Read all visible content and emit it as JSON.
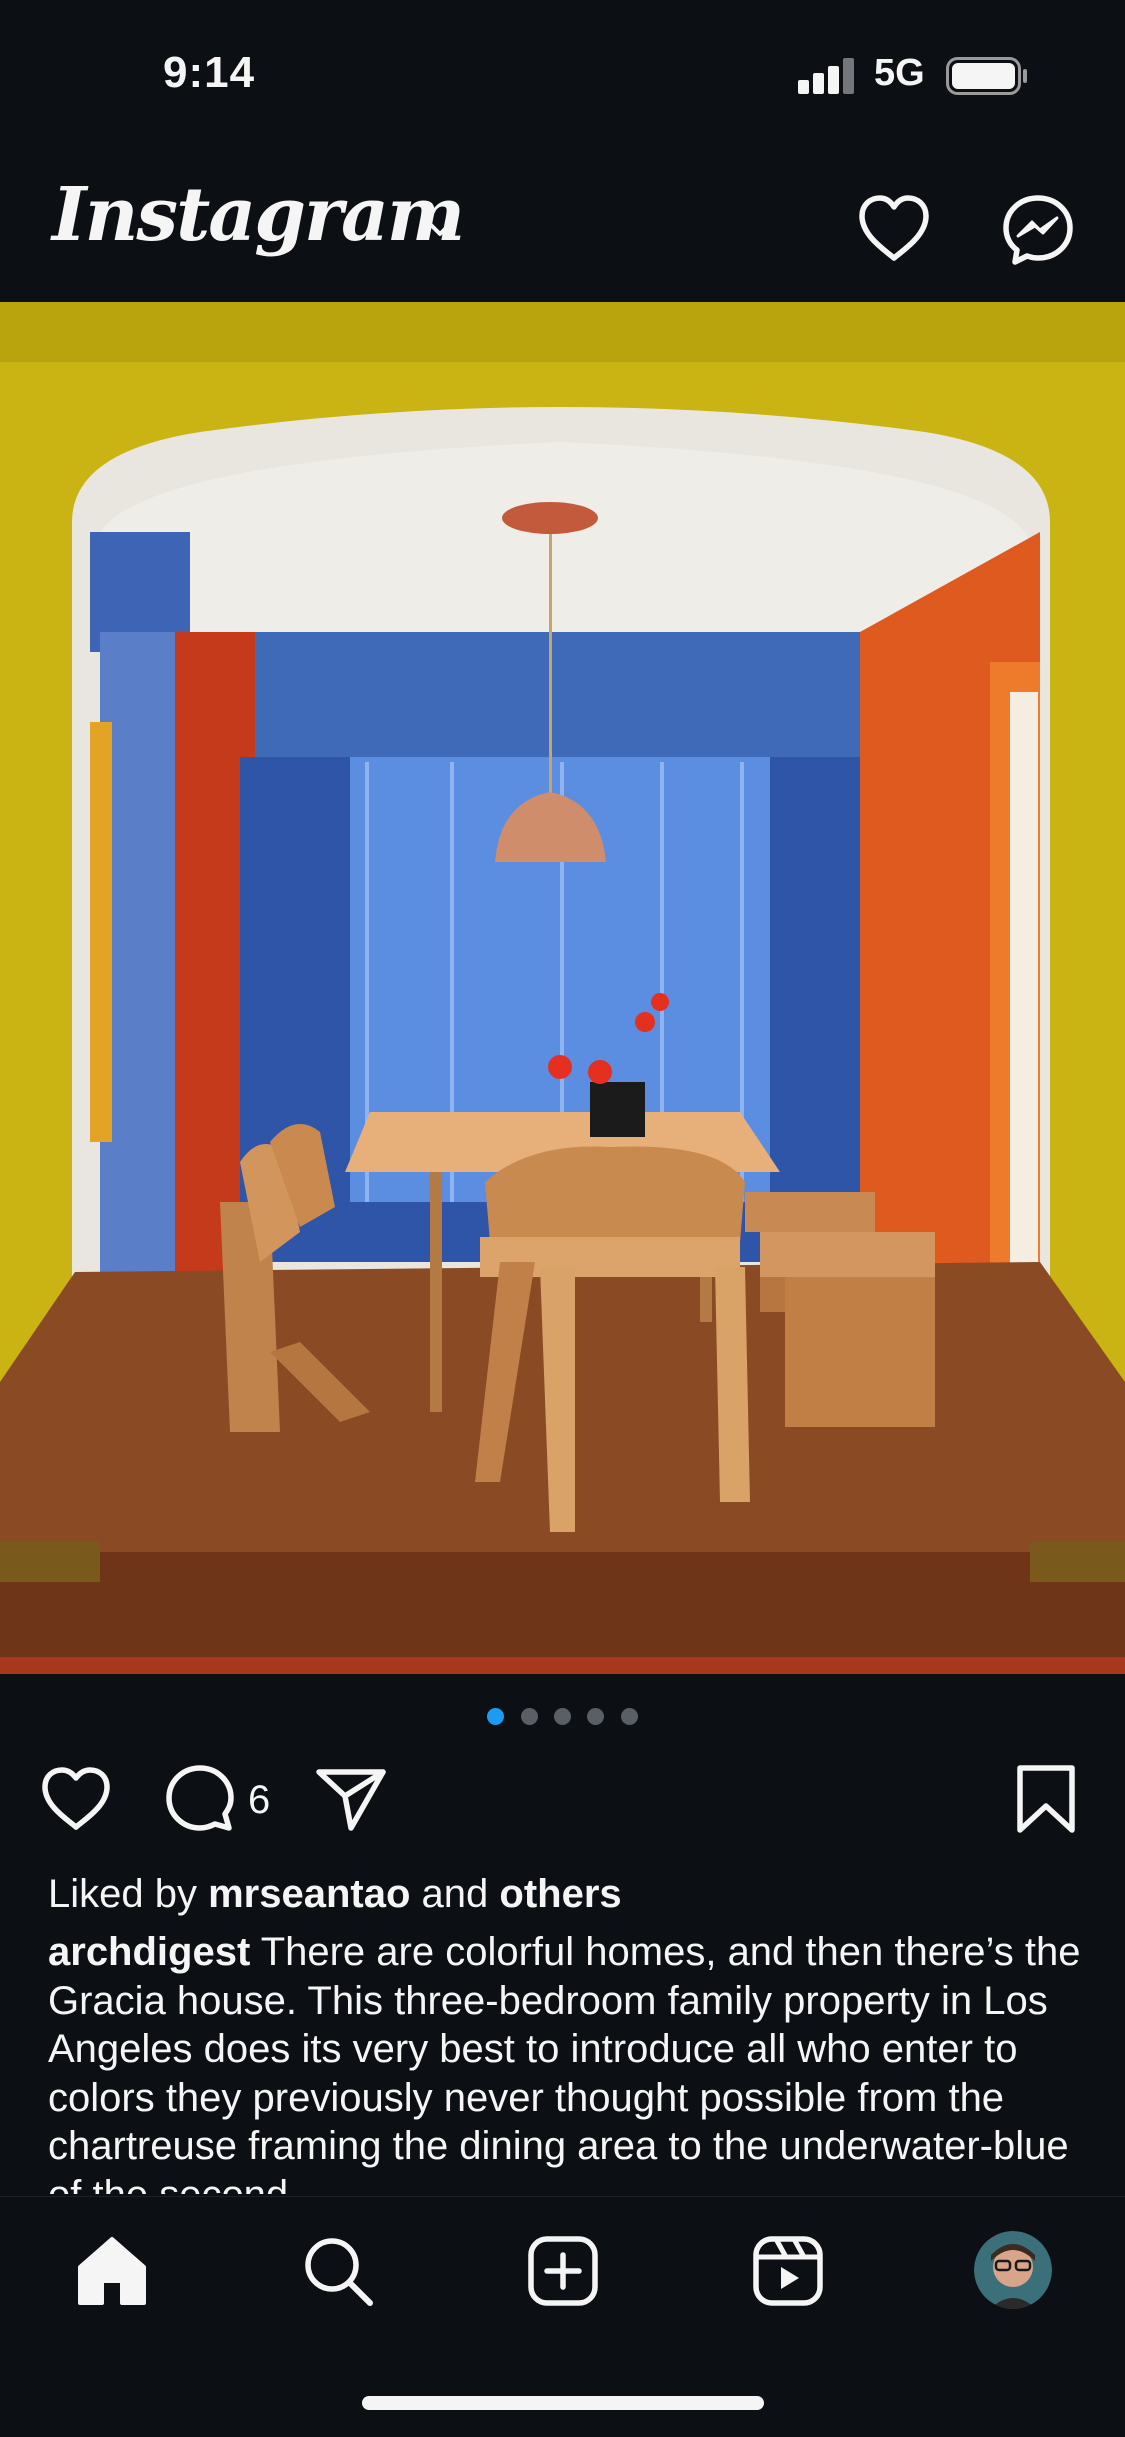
{
  "status_bar": {
    "time": "9:14",
    "network": "5G"
  },
  "header": {
    "app_name": "Instagram"
  },
  "post": {
    "image_alt": "Dining room framed by a chartreuse archway with blue curtains, orange walls, wooden table, chairs and benches",
    "carousel": {
      "count": 5,
      "active_index": 0
    },
    "comment_count": "6",
    "likes": {
      "prefix": "Liked by ",
      "user": "mrseantao",
      "middle": " and ",
      "others": "others"
    },
    "caption": {
      "username": "archdigest",
      "text": "There are colorful homes, and then there’s the Gracia house. This three-bedroom family property in Los Angeles does its very best to introduce all who enter to colors they previously never thought possible from the chartreuse framing the dining area to the underwater-blue of the second"
    }
  },
  "colors": {
    "accent": "#1d9bf0",
    "background": "#0c0f14",
    "text": "#f5f5f5"
  },
  "icons": {
    "header": [
      "heart-icon",
      "messenger-icon",
      "chevron-down-icon"
    ],
    "actions": [
      "like-icon",
      "comment-icon",
      "share-icon",
      "bookmark-icon"
    ],
    "nav": [
      "home-icon",
      "search-icon",
      "create-icon",
      "reels-icon",
      "profile-avatar"
    ]
  }
}
